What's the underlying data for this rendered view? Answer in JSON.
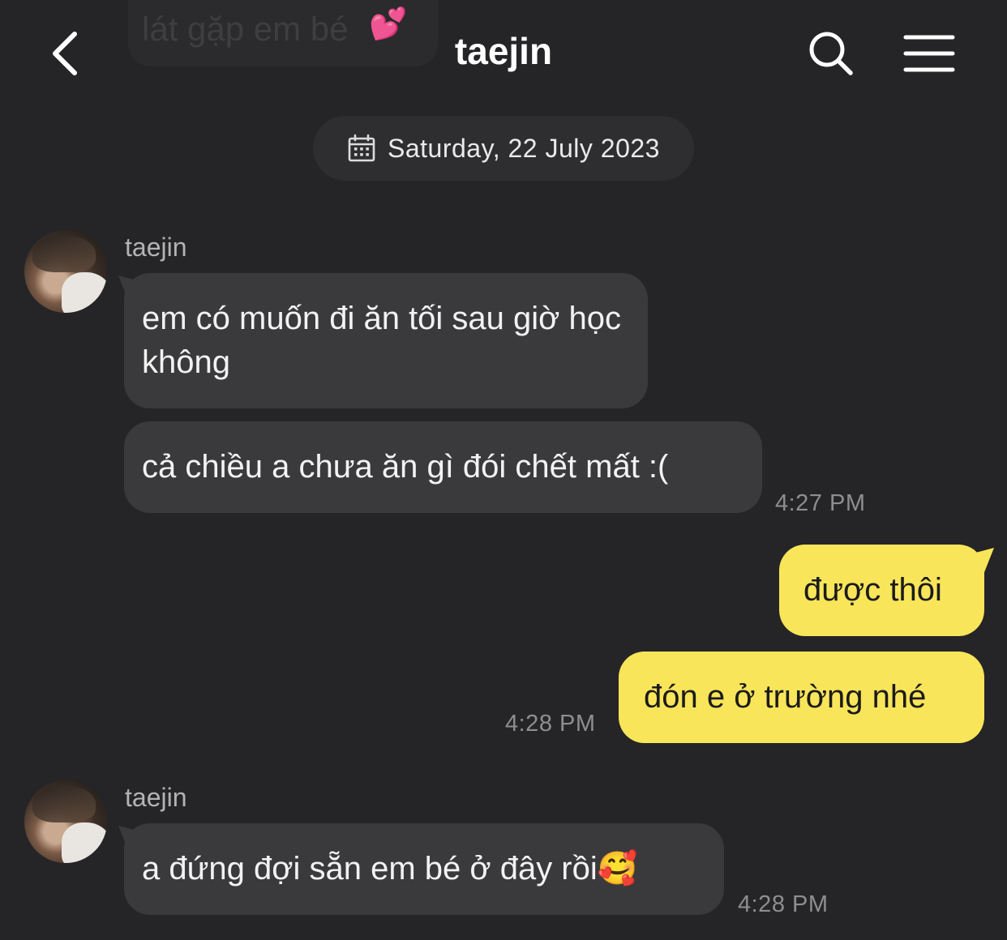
{
  "previous_message": {
    "text": "lát gặp em bé",
    "emoji": "💕"
  },
  "header": {
    "title": "taejin",
    "back_icon": "chevron-left-icon",
    "search_icon": "search-icon",
    "menu_icon": "hamburger-menu-icon"
  },
  "date_divider": {
    "icon": "calendar-icon",
    "text": "Saturday, 22 July 2023"
  },
  "messages": [
    {
      "sender": "taejin",
      "bubbles": [
        "em có muốn đi ăn tối sau giờ học không",
        "cả chiều a chưa ăn gì đói chết mất :("
      ],
      "time": "4:27 PM"
    },
    {
      "sender": "me",
      "bubbles": [
        "được thôi",
        "đón e ở trường nhé"
      ],
      "time": "4:28 PM"
    },
    {
      "sender": "taejin",
      "bubbles": [
        "a đứng đợi sẵn em bé ở đây rồi"
      ],
      "emoji": "🥰",
      "time": "4:28 PM"
    }
  ],
  "colors": {
    "background": "#252527",
    "incoming_bubble": "#3a3a3d",
    "outgoing_bubble": "#f9e55a",
    "timestamp": "#8e8e92"
  }
}
